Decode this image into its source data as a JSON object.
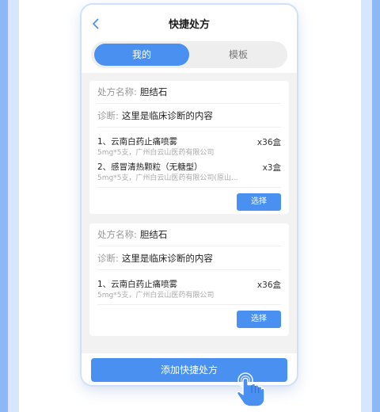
{
  "header": {
    "title": "快捷处方"
  },
  "tabs": [
    {
      "label": "我的",
      "active": true
    },
    {
      "label": "模板",
      "active": false
    }
  ],
  "prescriptions": [
    {
      "name_label": "处方名称:",
      "name_value": "胆结石",
      "diagnosis_label": "诊断:",
      "diagnosis_value": "这里是临床诊断的内容",
      "drugs": [
        {
          "name": "1、云南白药止痛喷雾",
          "qty": "x36盒",
          "desc": "5mg*5支，广州白云山医药有限公司"
        },
        {
          "name": "2、感冒清热颗粒（无糖型）",
          "qty": "x3盒",
          "desc": "5mg*5支，广州白云山医药有限公司(原山..."
        }
      ],
      "select_label": "选择"
    },
    {
      "name_label": "处方名称:",
      "name_value": "胆结石",
      "diagnosis_label": "诊断:",
      "diagnosis_value": "这里是临床诊断的内容",
      "drugs": [
        {
          "name": "1、云南白药止痛喷雾",
          "qty": "x36盒",
          "desc": "5mg*5支，广州白云山医药有限公司"
        }
      ],
      "select_label": "选择"
    }
  ],
  "footer": {
    "add_label": "添加快捷处方"
  },
  "colors": {
    "accent": "#4a90f0",
    "background": "#f2f2f2"
  },
  "icons": {
    "back": "chevron-left-icon",
    "hand": "pointing-hand-icon"
  }
}
